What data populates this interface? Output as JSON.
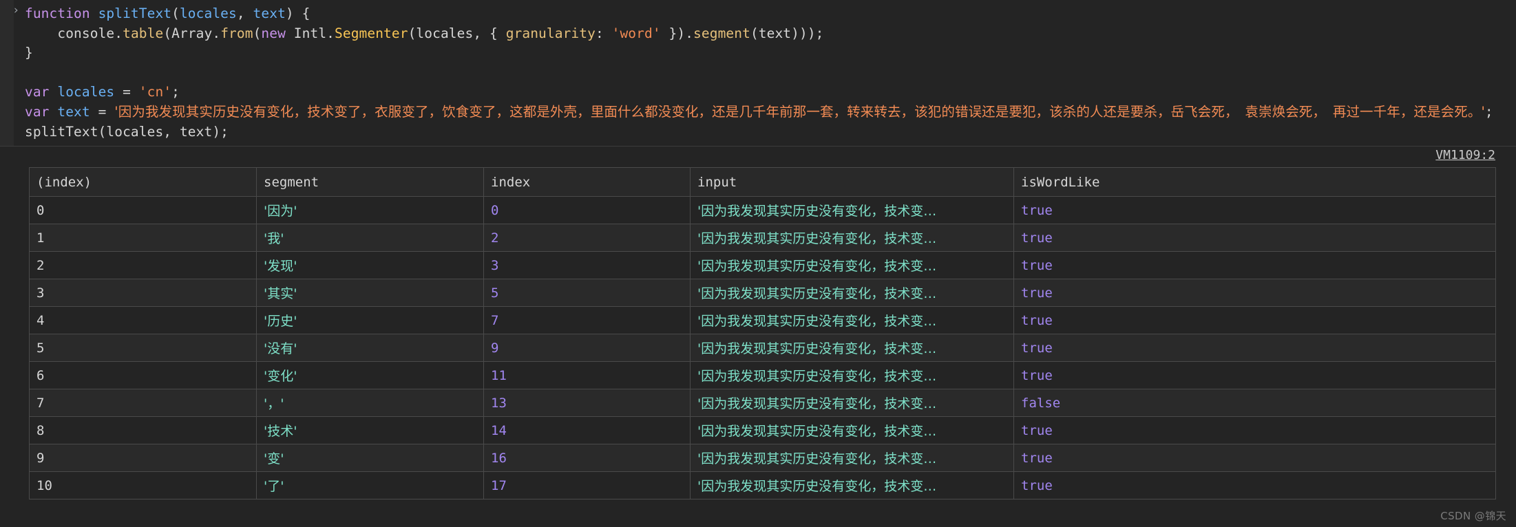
{
  "console": {
    "prompt_symbol": "›",
    "source_link": "VM1109:2",
    "code": {
      "line1_kw_function": "function ",
      "line1_fnname": "splitText",
      "line1_open": "(",
      "line1_arg1": "locales",
      "line1_comma": ", ",
      "line1_arg2": "text",
      "line1_close": ") {",
      "line2_indent": "    ",
      "line2_console": "console",
      "line2_dot1": ".",
      "line2_table": "table",
      "line2_p1": "(",
      "line2_array": "Array",
      "line2_dot2": ".",
      "line2_from": "from",
      "line2_p2": "(",
      "line2_new": "new ",
      "line2_intl": "Intl",
      "line2_dot3": ".",
      "line2_segmenter": "Segmenter",
      "line2_p3": "(",
      "line2_locales": "locales",
      "line2_comma": ", { ",
      "line2_granularity": "granularity",
      "line2_colon": ": ",
      "line2_word": "'word'",
      "line2_brace": " }).",
      "line2_segment": "segment",
      "line2_p4": "(",
      "line2_text": "text",
      "line2_tail": ")));",
      "line3_closebrace": "}",
      "line5_var": "var ",
      "line5_name": "locales",
      "line5_eq": " = ",
      "line5_val": "'cn'",
      "line5_semi": ";",
      "line6_var": "var ",
      "line6_name": "text",
      "line6_eq": " = ",
      "line6_val": "'因为我发现其实历史没有变化，技术变了，衣服变了，饮食变了，这都是外壳，里面什么都没变化，还是几千年前那一套，转来转去，该犯的错误还是要犯，该杀的人还是要杀，岳飞会死，　袁崇焕会死，　再过一千年，还是会死。'",
      "line6_semi": ";",
      "line7_call": "splitText(locales, text);"
    }
  },
  "table": {
    "columns": [
      "(index)",
      "segment",
      "index",
      "input",
      "isWordLike"
    ],
    "input_truncated": "'因为我发现其实历史没有变化，技术变…",
    "rows": [
      {
        "key": "0",
        "segment": "'因为'",
        "index": "0",
        "input": "'因为我发现其实历史没有变化，技术变…",
        "isWordLike": "true"
      },
      {
        "key": "1",
        "segment": "'我'",
        "index": "2",
        "input": "'因为我发现其实历史没有变化，技术变…",
        "isWordLike": "true"
      },
      {
        "key": "2",
        "segment": "'发现'",
        "index": "3",
        "input": "'因为我发现其实历史没有变化，技术变…",
        "isWordLike": "true"
      },
      {
        "key": "3",
        "segment": "'其实'",
        "index": "5",
        "input": "'因为我发现其实历史没有变化，技术变…",
        "isWordLike": "true"
      },
      {
        "key": "4",
        "segment": "'历史'",
        "index": "7",
        "input": "'因为我发现其实历史没有变化，技术变…",
        "isWordLike": "true"
      },
      {
        "key": "5",
        "segment": "'没有'",
        "index": "9",
        "input": "'因为我发现其实历史没有变化，技术变…",
        "isWordLike": "true"
      },
      {
        "key": "6",
        "segment": "'变化'",
        "index": "11",
        "input": "'因为我发现其实历史没有变化，技术变…",
        "isWordLike": "true"
      },
      {
        "key": "7",
        "segment": "'，'",
        "index": "13",
        "input": "'因为我发现其实历史没有变化，技术变…",
        "isWordLike": "false"
      },
      {
        "key": "8",
        "segment": "'技术'",
        "index": "14",
        "input": "'因为我发现其实历史没有变化，技术变…",
        "isWordLike": "true"
      },
      {
        "key": "9",
        "segment": "'变'",
        "index": "16",
        "input": "'因为我发现其实历史没有变化，技术变…",
        "isWordLike": "true"
      },
      {
        "key": "10",
        "segment": "'了'",
        "index": "17",
        "input": "'因为我发现其实历史没有变化，技术变…",
        "isWordLike": "true"
      }
    ]
  },
  "watermark": "CSDN @锦天",
  "colors": {
    "background": "#242424",
    "row_alt": "#2a2a2a",
    "border": "#4a4a4a",
    "keyword": "#c792ea",
    "function": "#6ab0f3",
    "property": "#e5c07b",
    "string": "#f28b54",
    "segment_value": "#7ee0c8",
    "number_value": "#a186f0"
  }
}
